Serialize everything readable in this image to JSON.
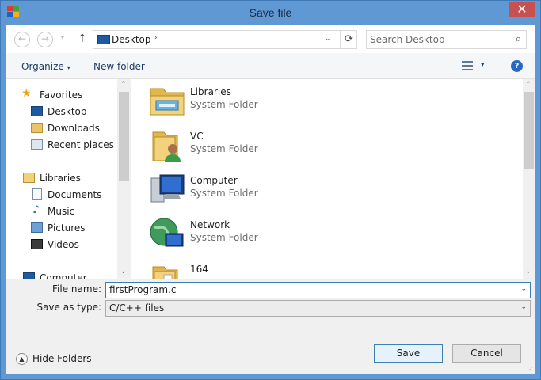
{
  "window": {
    "title": "Save file",
    "close_glyph": "✕"
  },
  "nav": {
    "back_glyph": "←",
    "forward_glyph": "→",
    "recent_glyph": "▾",
    "up_glyph": "↑",
    "address": {
      "location": "Desktop",
      "separator": "›",
      "dropdown_glyph": "⌄",
      "refresh_glyph": "⟳"
    },
    "search": {
      "placeholder": "Search Desktop",
      "icon_glyph": "⌕"
    }
  },
  "toolbar": {
    "organize_label": "Organize",
    "caret_glyph": "▾",
    "new_folder_label": "New folder",
    "help_glyph": "?"
  },
  "sidebar": {
    "favorites_label": "Favorites",
    "favorites": [
      {
        "label": "Desktop",
        "icon": "desktop-icon"
      },
      {
        "label": "Downloads",
        "icon": "downloads-icon"
      },
      {
        "label": "Recent places",
        "icon": "recent-places-icon"
      }
    ],
    "libraries_label": "Libraries",
    "libraries": [
      {
        "label": "Documents",
        "icon": "documents-icon"
      },
      {
        "label": "Music",
        "icon": "music-icon"
      },
      {
        "label": "Pictures",
        "icon": "pictures-icon"
      },
      {
        "label": "Videos",
        "icon": "videos-icon"
      }
    ],
    "computer_label": "Computer"
  },
  "files": [
    {
      "name": "Libraries",
      "type": "System Folder",
      "icon": "libraries-folder-icon"
    },
    {
      "name": "VC",
      "type": "System Folder",
      "icon": "user-folder-icon"
    },
    {
      "name": "Computer",
      "type": "System Folder",
      "icon": "computer-icon"
    },
    {
      "name": "Network",
      "type": "System Folder",
      "icon": "network-icon"
    },
    {
      "name": "164",
      "type": "",
      "icon": "folder-icon"
    }
  ],
  "form": {
    "file_name_label": "File name:",
    "file_name_value": "firstProgram.c",
    "save_type_label": "Save as type:",
    "save_type_value": "C/C++ files",
    "dropdown_glyph": "⌄"
  },
  "bottom": {
    "hide_folders_label": "Hide Folders",
    "hide_glyph": "▲",
    "save_label": "Save",
    "cancel_label": "Cancel"
  },
  "scroll": {
    "up_glyph": "⌃",
    "down_glyph": "⌄"
  },
  "colors": {
    "title_bar": "#5f98d3",
    "close_button": "#c75050",
    "accent": "#3c7fb1"
  }
}
